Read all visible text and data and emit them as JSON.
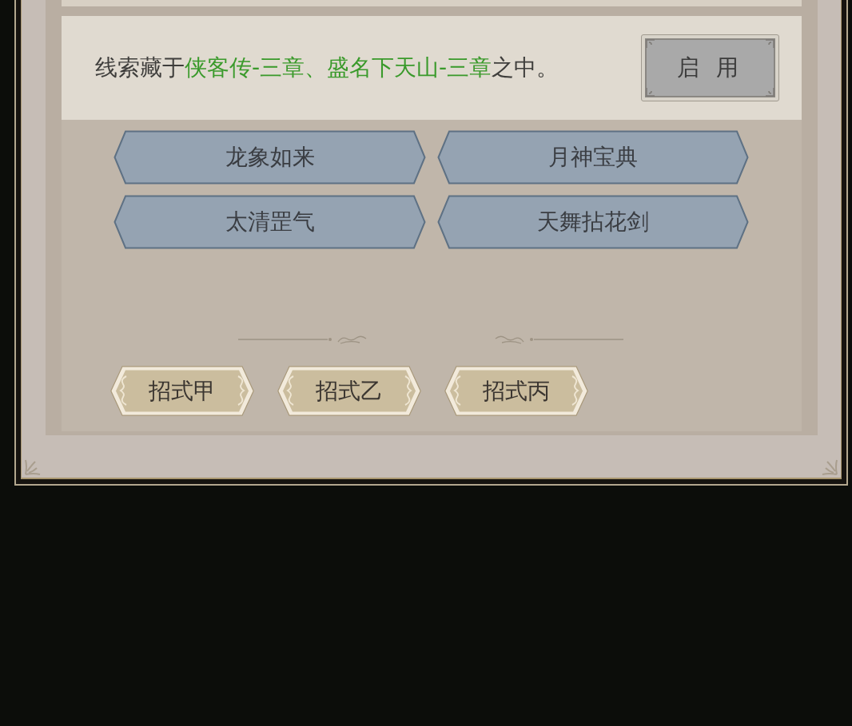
{
  "hint": {
    "segments": [
      {
        "text": "线索藏于",
        "highlight": false
      },
      {
        "text": "侠客传-三章、盛名下天山-三章",
        "highlight": true
      },
      {
        "text": "之中。",
        "highlight": false
      }
    ],
    "button": "启 用"
  },
  "skills": [
    "龙象如来",
    "月神宝典",
    "太清罡气",
    "天舞拈花剑"
  ],
  "moves": [
    "招式甲",
    "招式乙",
    "招式丙"
  ]
}
